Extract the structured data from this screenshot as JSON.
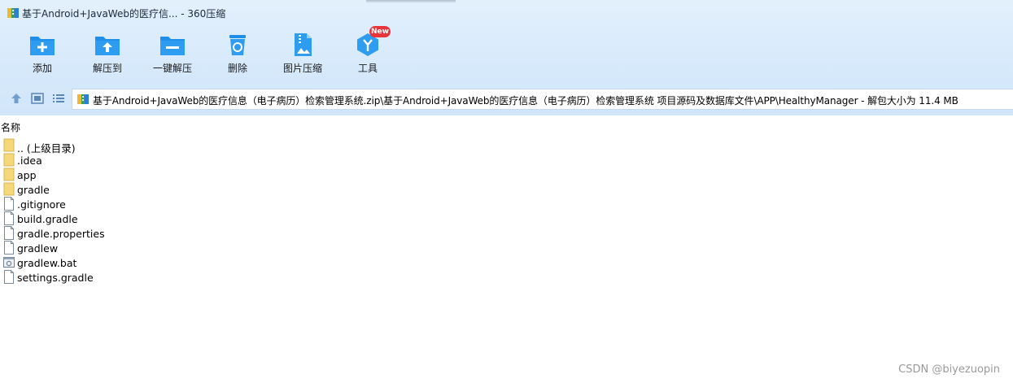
{
  "window": {
    "title": "基于Android+JavaWeb的医疗信... - 360压缩"
  },
  "toolbar": {
    "items": [
      {
        "label": "添加",
        "icon": "add-folder-icon"
      },
      {
        "label": "解压到",
        "icon": "extract-to-icon"
      },
      {
        "label": "一键解压",
        "icon": "one-click-extract-icon"
      },
      {
        "label": "删除",
        "icon": "recycle-bin-icon"
      },
      {
        "label": "图片压缩",
        "icon": "image-compress-icon"
      },
      {
        "label": "工具",
        "icon": "tools-icon",
        "badge": "New"
      }
    ]
  },
  "nav": {
    "path": "基于Android+JavaWeb的医疗信息（电子病历）检索管理系统.zip\\基于Android+JavaWeb的医疗信息（电子病历）检索管理系统 项目源码及数据库文件\\APP\\HealthyManager - 解包大小为 11.4 MB"
  },
  "list": {
    "column_name": "名称",
    "items": [
      {
        "name": ".. (上级目录)",
        "type": "folder"
      },
      {
        "name": ".idea",
        "type": "folder"
      },
      {
        "name": "app",
        "type": "folder"
      },
      {
        "name": "gradle",
        "type": "folder"
      },
      {
        "name": ".gitignore",
        "type": "file"
      },
      {
        "name": "build.gradle",
        "type": "file"
      },
      {
        "name": "gradle.properties",
        "type": "file"
      },
      {
        "name": "gradlew",
        "type": "file"
      },
      {
        "name": "gradlew.bat",
        "type": "bat"
      },
      {
        "name": "settings.gradle",
        "type": "file"
      }
    ]
  },
  "watermark": "CSDN @biyezuopin",
  "colors": {
    "toolbar_bg": "#d6e9fb",
    "icon_blue": "#1e8fe8",
    "badge_red": "#e8343a",
    "folder_yellow": "#f6d77a"
  }
}
